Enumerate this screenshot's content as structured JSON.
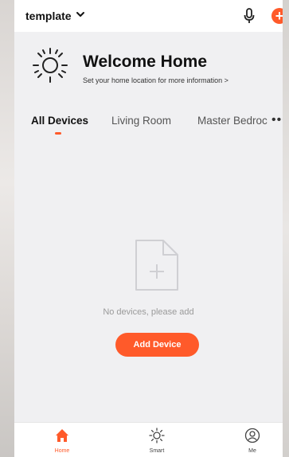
{
  "header": {
    "home_name": "template",
    "icons": {
      "dropdown": "chevron-down-icon",
      "mic": "microphone-icon",
      "add": "plus-circle-icon"
    },
    "add_symbol": "+"
  },
  "welcome": {
    "title": "Welcome Home",
    "subtitle": "Set your home location for more information >",
    "icon": "sun-icon"
  },
  "tabs": {
    "items": [
      {
        "label": "All Devices",
        "active": true
      },
      {
        "label": "Living Room",
        "active": false
      },
      {
        "label": "Master Bedroc",
        "active": false
      }
    ],
    "more_symbol": "•••"
  },
  "empty_state": {
    "icon": "add-document-icon",
    "message": "No devices, please add",
    "button_label": "Add Device"
  },
  "bottom_nav": {
    "items": [
      {
        "label": "Home",
        "icon": "home-icon",
        "active": true
      },
      {
        "label": "Smart",
        "icon": "sun-outline-icon",
        "active": false
      },
      {
        "label": "Me",
        "icon": "user-icon",
        "active": false
      }
    ]
  },
  "colors": {
    "accent": "#ff5a2a",
    "background": "#f0f0f2",
    "surface": "#ffffff",
    "text_primary": "#111111",
    "text_muted": "#9a9a9a"
  }
}
